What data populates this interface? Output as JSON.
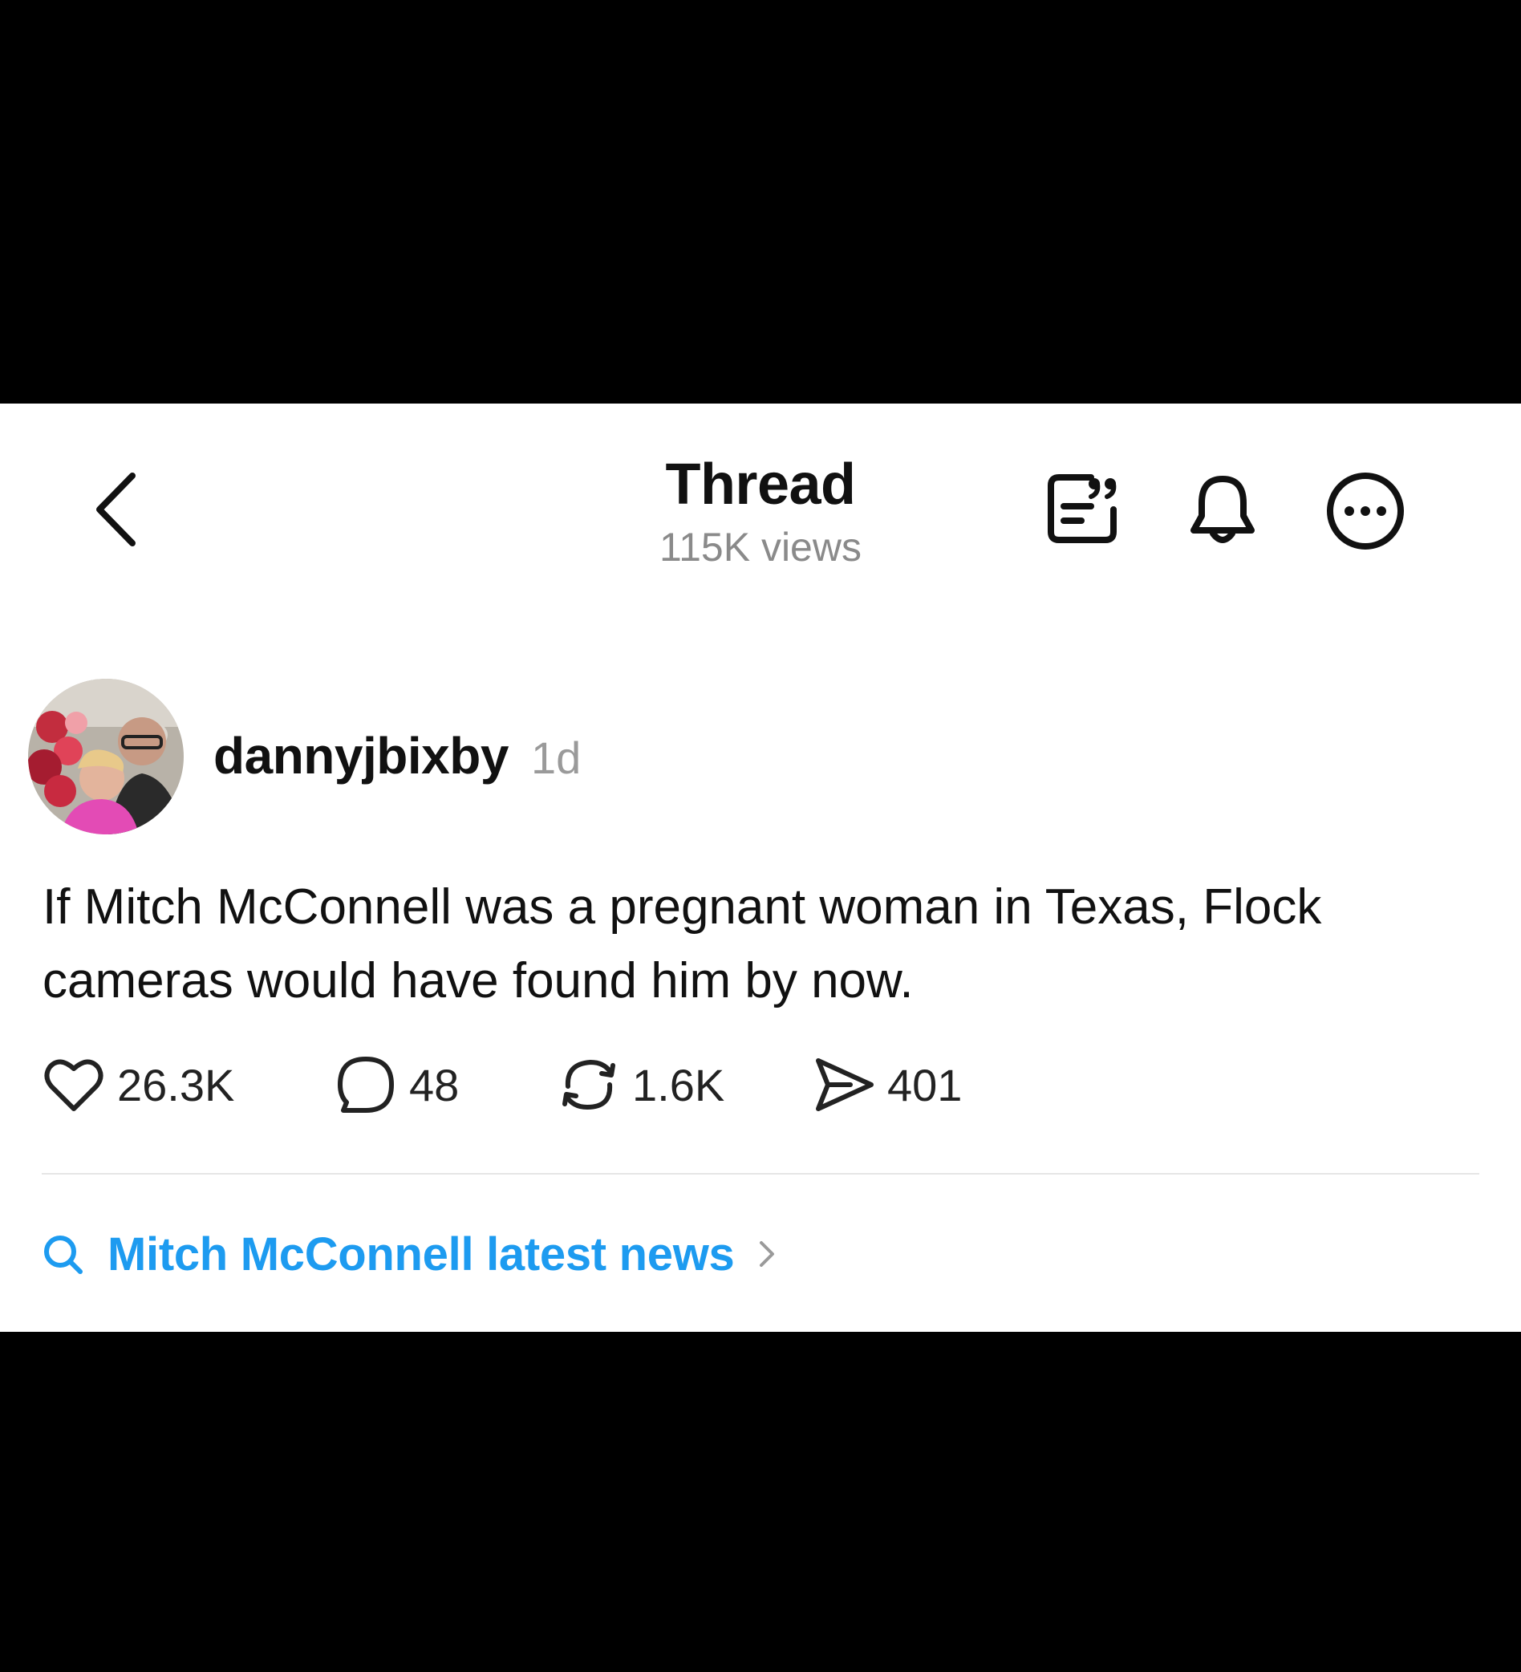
{
  "header": {
    "title": "Thread",
    "views": "115K views",
    "icons": [
      "back-icon",
      "quote-icon",
      "bell-icon",
      "more-icon"
    ]
  },
  "post": {
    "username": "dannyjbixby",
    "timestamp": "1d",
    "text": "If Mitch McConnell was a pregnant woman in Texas, Flock cameras would have found him by now.",
    "actions": {
      "likes": "26.3K",
      "replies": "48",
      "reposts": "1.6K",
      "shares": "401"
    }
  },
  "related_search": {
    "label": "Mitch McConnell latest news"
  },
  "colors": {
    "link": "#1d9bf0",
    "text": "#111111",
    "muted": "#8a8a8a",
    "background": "#ffffff",
    "letterbox": "#000000"
  }
}
